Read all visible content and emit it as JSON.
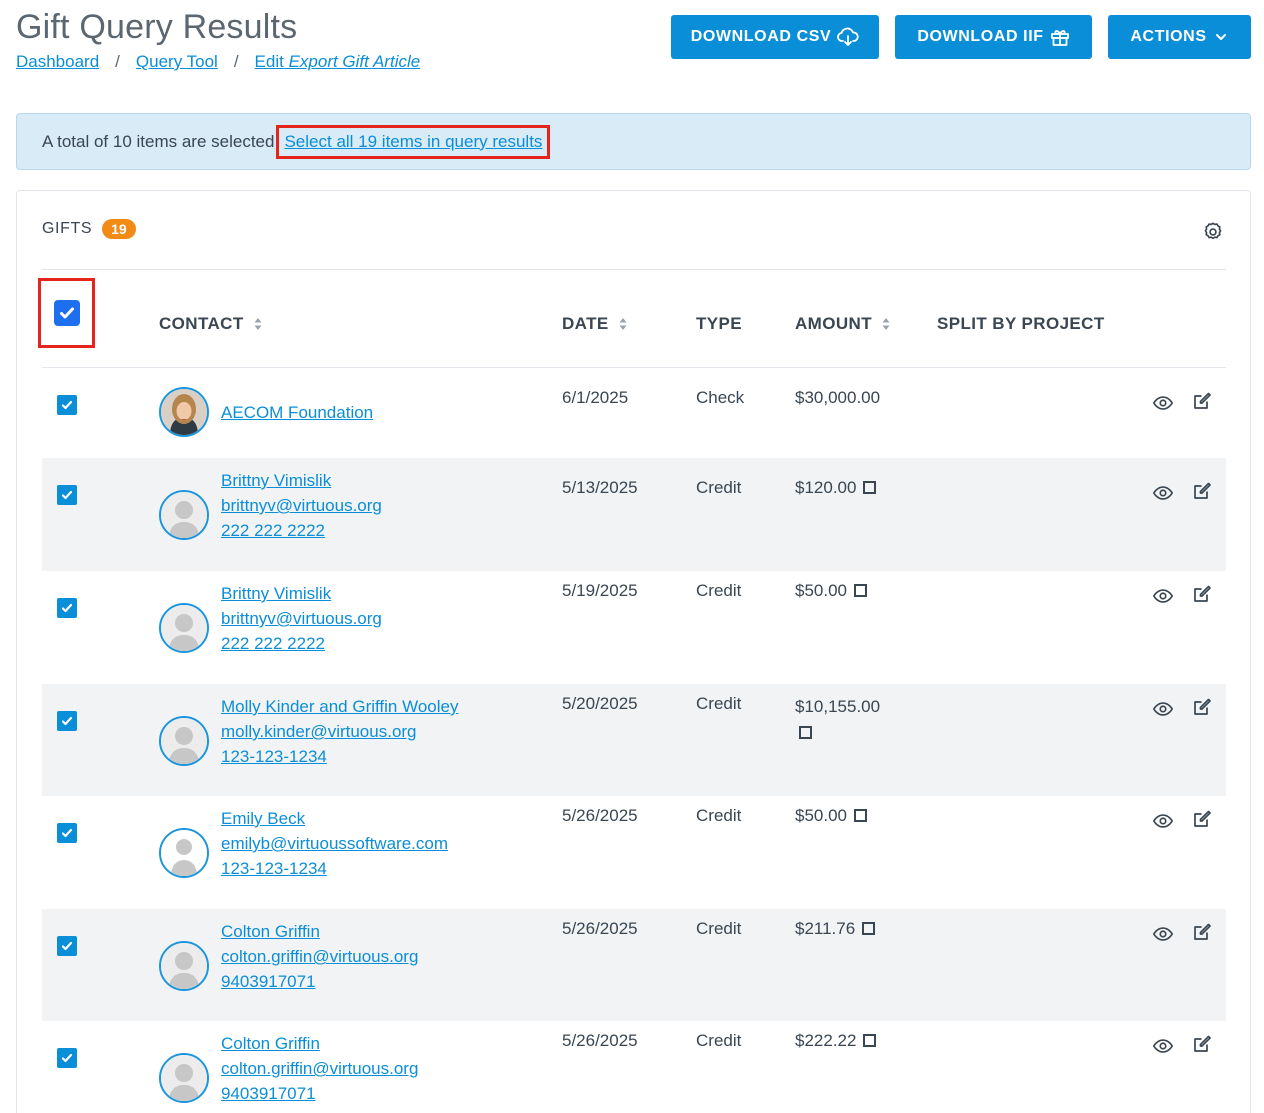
{
  "page": {
    "title": "Gift Query Results",
    "breadcrumb": {
      "dashboard": "Dashboard",
      "query_tool": "Query Tool",
      "edit_prefix": "Edit",
      "edit_name": "Export Gift Article",
      "separator": "/"
    }
  },
  "toolbar": {
    "download_csv": "DOWNLOAD CSV",
    "download_iif": "DOWNLOAD IIF",
    "actions": "ACTIONS"
  },
  "selection_alert": {
    "text": "A total of 10 items are selected",
    "select_all_link": "Select all 19 items in query results"
  },
  "gifts": {
    "label": "GIFTS",
    "count": "19",
    "columns": {
      "contact": "CONTACT",
      "date": "DATE",
      "type": "TYPE",
      "amount": "AMOUNT",
      "split": "SPLIT BY PROJECT"
    },
    "rows": [
      {
        "name": "AECOM Foundation",
        "email": "",
        "phone": "",
        "date": "6/1/2025",
        "type": "Check",
        "amount": "$30,000.00",
        "checked": true
      },
      {
        "name": "Brittny Vimislik",
        "email": "brittnyv@virtuous.org",
        "phone": "222 222 2222",
        "date": "5/13/2025",
        "type": "Credit",
        "amount": "$120.00",
        "checked": true
      },
      {
        "name": "Brittny Vimislik",
        "email": "brittnyv@virtuous.org",
        "phone": "222 222 2222",
        "date": "5/19/2025",
        "type": "Credit",
        "amount": "$50.00",
        "checked": true
      },
      {
        "name": "Molly Kinder and Griffin Wooley",
        "email": "molly.kinder@virtuous.org",
        "phone": "123-123-1234",
        "date": "5/20/2025",
        "type": "Credit",
        "amount": "$10,155.00",
        "checked": true
      },
      {
        "name": "Emily Beck",
        "email": "emilyb@virtuoussoftware.com",
        "phone": "123-123-1234",
        "date": "5/26/2025",
        "type": "Credit",
        "amount": "$50.00",
        "checked": true
      },
      {
        "name": "Colton Griffin",
        "email": "colton.griffin@virtuous.org",
        "phone": "9403917071",
        "date": "5/26/2025",
        "type": "Credit",
        "amount": "$211.76",
        "checked": true
      },
      {
        "name": "Colton Griffin",
        "email": "colton.griffin@virtuous.org",
        "phone": "9403917071",
        "date": "5/26/2025",
        "type": "Credit",
        "amount": "$222.22",
        "checked": true
      }
    ]
  },
  "colors": {
    "accent": "#0b8ed8",
    "badge": "#f28a16",
    "highlight": "#e5251c",
    "alert_bg": "#d8ebf7"
  }
}
